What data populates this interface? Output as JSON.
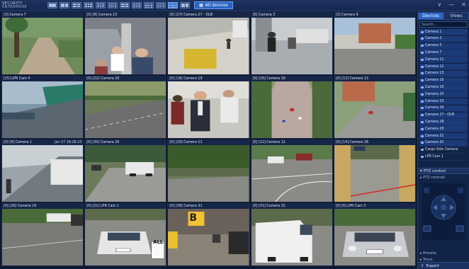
{
  "app": {
    "logo_line1": "SECURITY",
    "logo_line2": "ENTERPRISE",
    "all_devices_label": "All devices",
    "window_controls": [
      "∨",
      "—",
      "✕"
    ]
  },
  "layout_buttons": 12,
  "tiles": [
    {
      "label": "[3] Camera 7",
      "ts": "",
      "scene": "park"
    },
    {
      "label": "[0] [8] Camera 23",
      "ts": "",
      "scene": "escalator"
    },
    {
      "label": "[0] [27] Camera 27 - OLB",
      "ts": "",
      "scene": "lobby"
    },
    {
      "label": "[0] Camera 3",
      "ts": "",
      "scene": "street_people"
    },
    {
      "label": "[3] Camera 9",
      "ts": "",
      "scene": "building_lot"
    },
    {
      "label": "[15] LPR Cam 4",
      "ts": "",
      "scene": "bridge"
    },
    {
      "label": "[0] [22] Camera 20",
      "ts": "",
      "scene": "highway"
    },
    {
      "label": "[0] [18] Camera 19",
      "ts": "",
      "scene": "office_people"
    },
    {
      "label": "[0] [16] Camera 16",
      "ts": "",
      "scene": "plaza"
    },
    {
      "label": "[0] [13] Camera 13",
      "ts": "",
      "scene": "campus"
    },
    {
      "label": "[0] [9] Camera 1",
      "ts": "Jan 27 18:28:23",
      "scene": "station"
    },
    {
      "label": "[0] [30] Camera 26",
      "ts": "",
      "scene": "driveway"
    },
    {
      "label": "[0] [20] Camera 11",
      "ts": "",
      "scene": "road_trees"
    },
    {
      "label": "[0] [12] Camera 12",
      "ts": "",
      "scene": "intersection"
    },
    {
      "label": "[0] [14] Camera 28",
      "ts": "",
      "scene": "gate"
    },
    {
      "label": "[0] [29] Camera 29",
      "ts": "",
      "scene": "parking_road"
    },
    {
      "label": "[0] [21] LPR Cam 1",
      "ts": "",
      "scene": "white_car"
    },
    {
      "label": "[0] [28] Camera 31",
      "ts": "",
      "scene": "garage"
    },
    {
      "label": "[0] [31] Camera 32",
      "ts": "",
      "scene": "van"
    },
    {
      "label": "[0] [6] LPR Cam 3",
      "ts": "",
      "scene": "silver_car"
    }
  ],
  "overlay_signs": {
    "stop_sign": "ALL",
    "garage_letter": "B"
  },
  "panel": {
    "tab_devices": "Devices",
    "tab_views": "Views",
    "search_placeholder": "Search...",
    "devices": [
      "Camera 1",
      "Camera 3",
      "Camera 5",
      "Camera 7",
      "Camera 11",
      "Camera 12",
      "Camera 13",
      "Camera 16",
      "Camera 19",
      "Camera 20",
      "Camera 23",
      "Camera 26",
      "Camera 27 - OLB",
      "Camera 28",
      "Camera 29",
      "Camera 31",
      "Camera 32",
      "Cargo Side Camera",
      "LPR Cam 1",
      "LPR Cam 3"
    ],
    "ptz_control": "PTZ control",
    "ptz_controls": "PTZ controls",
    "presets": "Presets:",
    "tours": "Tours:",
    "export": "Export"
  },
  "colors": {
    "accent": "#2b64c6",
    "background": "#0e1a33",
    "panel": "#112347"
  }
}
